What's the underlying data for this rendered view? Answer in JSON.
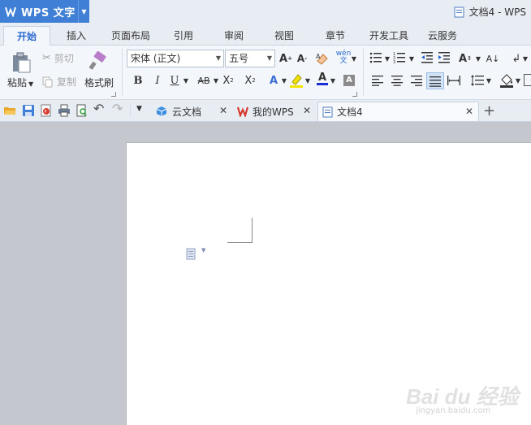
{
  "app": {
    "name": "WPS 文字",
    "window_title": "文档4 - WPS"
  },
  "ribbon_tabs": [
    {
      "label": "开始"
    },
    {
      "label": "插入"
    },
    {
      "label": "页面布局"
    },
    {
      "label": "引用"
    },
    {
      "label": "审阅"
    },
    {
      "label": "视图"
    },
    {
      "label": "章节"
    },
    {
      "label": "开发工具"
    },
    {
      "label": "云服务"
    }
  ],
  "clipboard": {
    "paste": "粘贴",
    "cut": "剪切",
    "copy": "复制",
    "format_painter": "格式刷"
  },
  "font": {
    "name": "宋体 (正文)",
    "size": "五号"
  },
  "doc_tabs": [
    {
      "label": "云文档"
    },
    {
      "label": "我的WPS"
    },
    {
      "label": "文档4"
    }
  ],
  "watermark": {
    "brand": "Bai du 经验",
    "url": "jingyan.baidu.com"
  },
  "colors": {
    "accent": "#3f7fd6",
    "active_tab": "#2a6ad1",
    "font_color_bar": "#1a2fd1",
    "highlight_bar": "#f2e300"
  }
}
